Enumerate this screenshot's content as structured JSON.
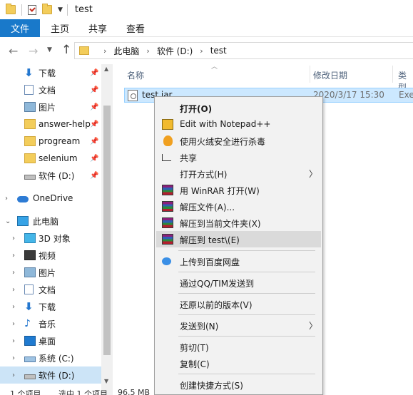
{
  "window": {
    "title": "test"
  },
  "ribbon": {
    "tabs": [
      "文件",
      "主页",
      "共享",
      "查看"
    ]
  },
  "address": {
    "crumbs": [
      "此电脑",
      "软件 (D:)",
      "test"
    ]
  },
  "nav": {
    "quick_access": [
      {
        "label": "下载",
        "icon": "download-icon",
        "pinned": true
      },
      {
        "label": "文档",
        "icon": "document-icon",
        "pinned": true
      },
      {
        "label": "图片",
        "icon": "pictures-icon",
        "pinned": true
      },
      {
        "label": "answer-help",
        "icon": "folder-icon",
        "pinned": true
      },
      {
        "label": "progream",
        "icon": "folder-icon",
        "pinned": true
      },
      {
        "label": "selenium",
        "icon": "folder-icon",
        "pinned": true
      },
      {
        "label": "软件 (D:)",
        "icon": "drive-icon",
        "pinned": true
      }
    ],
    "onedrive": "OneDrive",
    "this_pc": "此电脑",
    "pc_items": [
      "3D 对象",
      "视频",
      "图片",
      "文档",
      "下载",
      "音乐",
      "桌面",
      "系统 (C:)",
      "软件 (D:)"
    ]
  },
  "columns": {
    "name": "名称",
    "date": "修改日期",
    "type": "类型"
  },
  "file": {
    "name": "test.jar",
    "date": "2020/3/17 15:30",
    "type": "Exe"
  },
  "status": {
    "count": "1 个项目",
    "selected": "选中 1 个项目",
    "size": "96.5 MB"
  },
  "context_menu": {
    "open": "打开(O)",
    "notepadpp": "Edit with Notepad++",
    "huorong": "使用火绒安全进行杀毒",
    "share": "共享",
    "open_with": "打开方式(H)",
    "winrar_open": "用 WinRAR 打开(W)",
    "extract_files": "解压文件(A)...",
    "extract_here": "解压到当前文件夹(X)",
    "extract_to": "解压到 test\\(E)",
    "baidu": "上传到百度网盘",
    "qq_send": "通过QQ/TIM发送到",
    "restore": "还原以前的版本(V)",
    "send_to": "发送到(N)",
    "cut": "剪切(T)",
    "copy": "复制(C)",
    "shortcut": "创建快捷方式(S)"
  }
}
